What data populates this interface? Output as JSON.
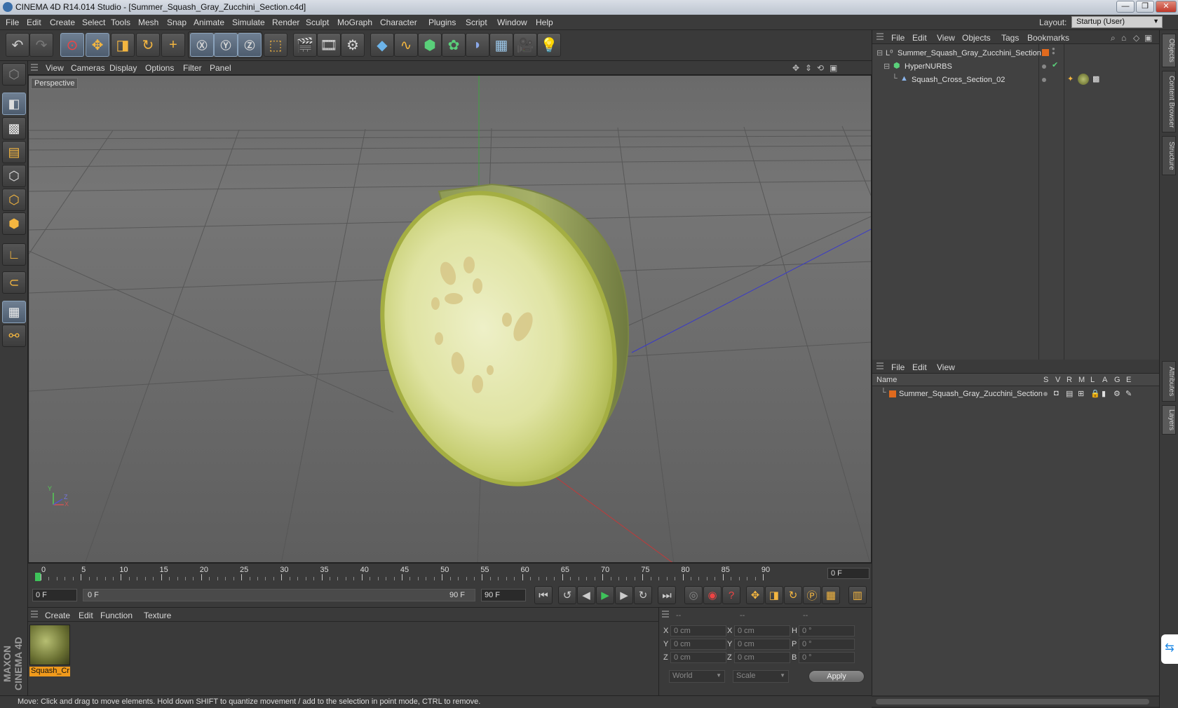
{
  "window": {
    "title": "CINEMA 4D R14.014 Studio - [Summer_Squash_Gray_Zucchini_Section.c4d]",
    "buttons": [
      "—",
      "❐",
      "✕"
    ]
  },
  "menubar": {
    "items": [
      "File",
      "Edit",
      "Create",
      "Select",
      "Tools",
      "Mesh",
      "Snap",
      "Animate",
      "Simulate",
      "Render",
      "Sculpt",
      "MoGraph",
      "Character",
      "Plugins",
      "Script",
      "Window",
      "Help"
    ],
    "layout_label": "Layout:",
    "layout_value": "Startup (User)"
  },
  "toolbar": {
    "icons": [
      "undo-icon",
      "redo-icon",
      "live-selection-icon",
      "move-icon",
      "scale-icon",
      "rotate-icon",
      "add-icon",
      "x-axis-icon",
      "y-axis-icon",
      "z-axis-icon",
      "world-coords-icon",
      "render-view-icon",
      "render-picture-viewer-icon",
      "render-settings-icon",
      "cube-icon",
      "spline-icon",
      "nurbs-icon",
      "array-icon",
      "deformer-icon",
      "scene-icon",
      "camera-icon",
      "light-icon"
    ]
  },
  "lefttools": {
    "icons": [
      "make-editable-icon",
      "model-mode-icon",
      "texture-mode-icon",
      "workplane-icon",
      "points-mode-icon",
      "edges-mode-icon",
      "polygons-mode-icon",
      "axis-mode-icon",
      "magnet-icon",
      "snap-icon",
      "locked-workplane-icon"
    ]
  },
  "viewport": {
    "menu": [
      "View",
      "Cameras",
      "Display",
      "Options",
      "Filter",
      "Panel"
    ],
    "label": "Perspective",
    "axis_labels": {
      "y": "Y",
      "x": "X",
      "z": "Z"
    }
  },
  "timeline": {
    "ticks": [
      "0",
      "5",
      "10",
      "15",
      "20",
      "25",
      "30",
      "35",
      "40",
      "45",
      "50",
      "55",
      "60",
      "65",
      "70",
      "75",
      "80",
      "85",
      "90"
    ],
    "current_frame": "0 F"
  },
  "transport": {
    "start_field": "0 F",
    "range_start": "0 F",
    "range_end": "90 F",
    "end_field": "90 F"
  },
  "materials": {
    "menu": [
      "Create",
      "Edit",
      "Function",
      "Texture"
    ],
    "items": [
      {
        "name": "Squash_Cr"
      }
    ]
  },
  "coords": {
    "header": [
      "--",
      "--",
      "--"
    ],
    "rows": [
      {
        "a": "X",
        "v1": "0 cm",
        "b": "X",
        "v2": "0 cm",
        "c": "H",
        "v3": "0 °"
      },
      {
        "a": "Y",
        "v1": "0 cm",
        "b": "Y",
        "v2": "0 cm",
        "c": "P",
        "v3": "0 °"
      },
      {
        "a": "Z",
        "v1": "0 cm",
        "b": "Z",
        "v2": "0 cm",
        "c": "B",
        "v3": "0 °"
      }
    ],
    "mode1": "World",
    "mode2": "Scale",
    "apply": "Apply"
  },
  "objects": {
    "menu": [
      "File",
      "Edit",
      "View",
      "Objects",
      "Tags",
      "Bookmarks"
    ],
    "rows": [
      {
        "name": "Summer_Squash_Gray_Zucchini_Section"
      },
      {
        "name": "HyperNURBS"
      },
      {
        "name": "Squash_Cross_Section_02"
      }
    ]
  },
  "layers": {
    "menu": [
      "File",
      "Edit",
      "View"
    ],
    "header_name": "Name",
    "columns": [
      "S",
      "V",
      "R",
      "M",
      "L",
      "A",
      "G",
      "E"
    ],
    "rows": [
      {
        "name": "Summer_Squash_Gray_Zucchini_Section"
      }
    ]
  },
  "rightstrip": {
    "tabs": [
      "Objects",
      "Content Browser",
      "Structure",
      "Attributes",
      "Layers"
    ]
  },
  "status": "Move: Click and drag to move elements. Hold down SHIFT to quantize movement / add to the selection in point mode, CTRL to remove.",
  "branding": {
    "logo": "MAXON CINEMA 4D"
  }
}
